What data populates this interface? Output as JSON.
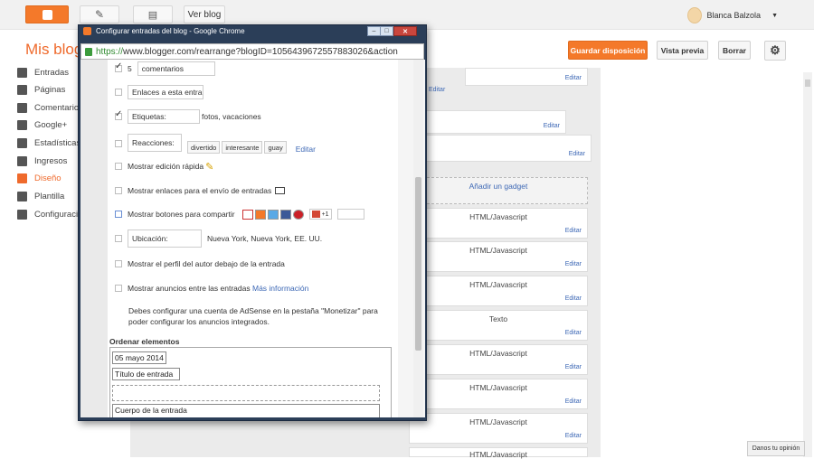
{
  "topbar": {
    "view_blog_label": "Ver blog",
    "user_name": "Blanca Balzola"
  },
  "header": {
    "title": "Mis blogs",
    "save_layout_label": "Guardar disposición",
    "preview_label": "Vista previa",
    "delete_label": "Borrar"
  },
  "sidebar": {
    "items": [
      {
        "label": "Entradas",
        "icon": "posts-icon"
      },
      {
        "label": "Páginas",
        "icon": "pages-icon"
      },
      {
        "label": "Comentarios",
        "icon": "comments-icon"
      },
      {
        "label": "Google+",
        "icon": "google-plus-icon"
      },
      {
        "label": "Estadísticas",
        "icon": "stats-icon"
      },
      {
        "label": "Ingresos",
        "icon": "earnings-icon"
      },
      {
        "label": "Diseño",
        "icon": "layout-icon",
        "active": true
      },
      {
        "label": "Plantilla",
        "icon": "template-icon"
      },
      {
        "label": "Configuración",
        "icon": "settings-icon"
      }
    ]
  },
  "layout": {
    "edit_label": "Editar",
    "add_gadget_label": "Añadir un gadget",
    "gadgets": [
      "HTML/Javascript",
      "HTML/Javascript",
      "HTML/Javascript",
      "Texto",
      "HTML/Javascript",
      "HTML/Javascript",
      "HTML/Javascript",
      "HTML/Javascript"
    ]
  },
  "window": {
    "title": "Configurar entradas del blog - Google Chrome",
    "url_scheme": "https://",
    "url_rest": "www.blogger.com/rearrange?blogID=1056439672557883026&action"
  },
  "settings": {
    "comments_count": "5",
    "comments_label": "comentarios",
    "links_label": "Enlaces a esta entra",
    "tags_label": "Etiquetas:",
    "tags_value": "fotos, vacaciones",
    "reactions_label": "Reacciones:",
    "reactions": [
      "divertido",
      "interesante",
      "guay"
    ],
    "reactions_edit": "Editar",
    "quick_edit_label": "Mostrar edición rápida",
    "email_links_label": "Mostrar enlaces para el envío de entradas",
    "share_buttons_label": "Mostrar botones para compartir",
    "plusone_label": "+1",
    "location_label": "Ubicación:",
    "location_value": "Nueva York, Nueva York, EE. UU.",
    "author_profile_label": "Mostrar el perfil del autor debajo de la entrada",
    "ads_label": "Mostrar anuncios entre las entradas",
    "ads_more": "Más información",
    "adsense_note_1": "Debes configurar una cuenta de AdSense en la pestaña \"Monetizar\" para",
    "adsense_note_2": "poder configurar los anuncios integrados.",
    "order_title": "Ordenar elementos",
    "order_date": "05 mayo 2014",
    "order_post_title": "Título de entrada",
    "order_post_body": "Cuerpo de la entrada"
  },
  "footer": {
    "feedback_label": "Danos tu opinión"
  }
}
